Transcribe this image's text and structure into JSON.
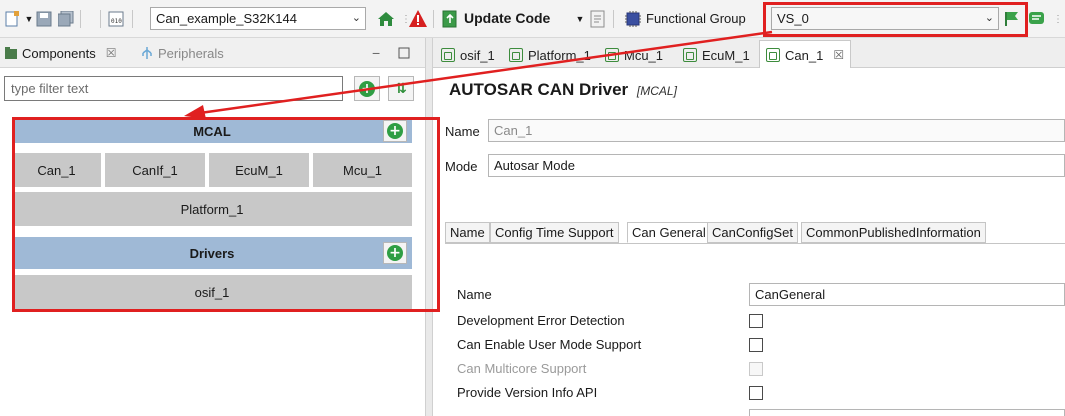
{
  "toolbar": {
    "project_select": "Can_example_S32K144",
    "update_code_label": "Update Code",
    "functional_group_label": "Functional Group",
    "functional_group_value": "VS_0"
  },
  "left_panel": {
    "tabs": [
      {
        "label": "Components",
        "active": true
      },
      {
        "label": "Peripherals",
        "active": false
      }
    ],
    "filter_placeholder": "type filter text",
    "groups": [
      {
        "title": "MCAL",
        "components": [
          "Can_1",
          "CanIf_1",
          "EcuM_1",
          "Mcu_1",
          "Platform_1"
        ]
      },
      {
        "title": "Drivers",
        "components": [
          "osif_1"
        ]
      }
    ]
  },
  "editor": {
    "tabs": [
      "osif_1",
      "Platform_1",
      "Mcu_1",
      "EcuM_1",
      "Can_1"
    ],
    "active_tab": "Can_1",
    "title": "AUTOSAR CAN Driver",
    "title_tag": "[MCAL]",
    "name_label": "Name",
    "name_value": "Can_1",
    "mode_label": "Mode",
    "mode_value": "Autosar Mode",
    "subtabs": [
      "Name",
      "Config Time Support",
      "Can General",
      "CanConfigSet",
      "CommonPublishedInformation"
    ],
    "active_subtab": "Can General",
    "general": {
      "name_label": "Name",
      "name_value": "CanGeneral",
      "rows": [
        {
          "label": "Development Error Detection",
          "enabled": true,
          "checked": false
        },
        {
          "label": "Can Enable User Mode Support",
          "enabled": true,
          "checked": false
        },
        {
          "label": "Can Multicore Support",
          "enabled": false,
          "checked": false
        },
        {
          "label": "Provide Version Info API",
          "enabled": true,
          "checked": false
        }
      ]
    }
  },
  "colors": {
    "annotation_red": "#e02020",
    "group_header": "#9fb9d6",
    "component_tile": "#c8c8c8",
    "accent_green": "#2f9e44"
  }
}
